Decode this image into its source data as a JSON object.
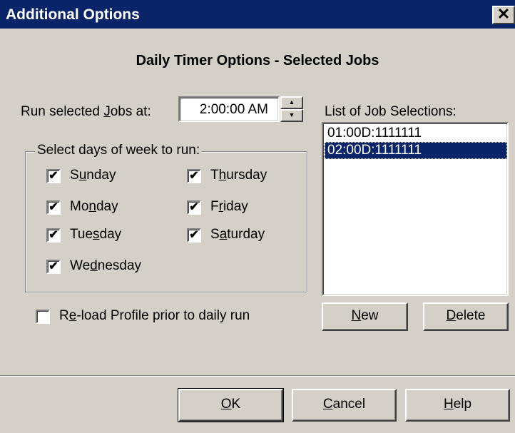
{
  "window": {
    "title": "Additional Options",
    "close_glyph": "✕"
  },
  "heading": "Daily Timer Options - Selected Jobs",
  "run_at": {
    "label_pre": "Run selected ",
    "label_accel": "J",
    "label_post": "obs at:",
    "time_value": "2:00:00 AM"
  },
  "days_group": {
    "label": "Select days of week to run:",
    "days": [
      {
        "pre": "S",
        "accel": "u",
        "post": "nday",
        "checked": true
      },
      {
        "pre": "Mo",
        "accel": "n",
        "post": "day",
        "checked": true
      },
      {
        "pre": "Tue",
        "accel": "s",
        "post": "day",
        "checked": true
      },
      {
        "pre": "We",
        "accel": "d",
        "post": "nesday",
        "checked": true
      },
      {
        "pre": "T",
        "accel": "h",
        "post": "ursday",
        "checked": true
      },
      {
        "pre": "F",
        "accel": "r",
        "post": "iday",
        "checked": true
      },
      {
        "pre": "S",
        "accel": "a",
        "post": "turday",
        "checked": true
      }
    ]
  },
  "reload": {
    "pre": "R",
    "accel": "e",
    "post": "-load Profile prior to daily run",
    "checked": false
  },
  "job_list": {
    "label": "List of Job Selections:",
    "items": [
      "01:00D:1111111",
      "02:00D:1111111"
    ],
    "selected_index": 1
  },
  "buttons": {
    "new": {
      "accel": "N",
      "post": "ew"
    },
    "delete": {
      "accel": "D",
      "post": "elete"
    },
    "ok": {
      "accel": "O",
      "post": "K"
    },
    "cancel": {
      "accel": "C",
      "post": "ancel"
    },
    "help": {
      "accel": "H",
      "post": "elp"
    }
  },
  "check_glyph": "✔"
}
